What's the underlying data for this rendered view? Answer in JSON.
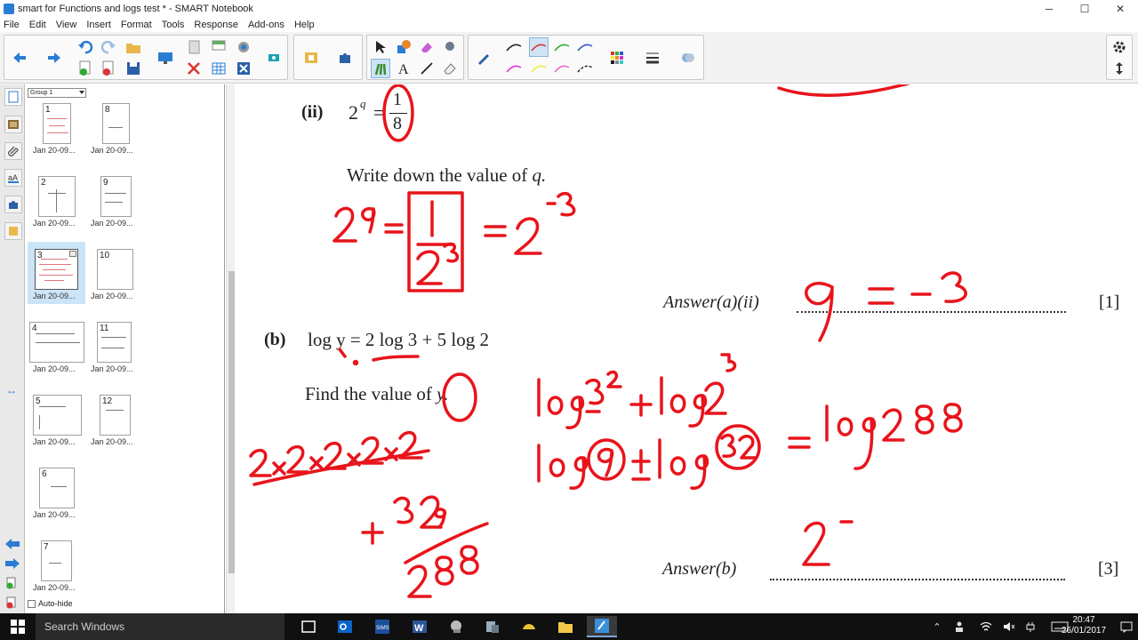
{
  "window": {
    "title": "smart for Functions and logs test * - SMART Notebook",
    "minimize": "─",
    "maximize": "☐",
    "close": "✕"
  },
  "menu": [
    "File",
    "Edit",
    "View",
    "Insert",
    "Format",
    "Tools",
    "Response",
    "Add-ons",
    "Help"
  ],
  "sorter": {
    "group": "Group 1",
    "autohide_label": "Auto-hide",
    "pages": [
      {
        "num": "1",
        "label": "Jan  20-09..."
      },
      {
        "num": "2",
        "label": "Jan  20-09..."
      },
      {
        "num": "3",
        "label": "Jan  20-09..."
      },
      {
        "num": "4",
        "label": "Jan  20-09..."
      },
      {
        "num": "5",
        "label": "Jan  20-09..."
      },
      {
        "num": "6",
        "label": "Jan  20-09..."
      },
      {
        "num": "7",
        "label": "Jan  20-09..."
      },
      {
        "num": "8",
        "label": "Jan  20-09..."
      },
      {
        "num": "9",
        "label": "Jan  20-09..."
      },
      {
        "num": "10",
        "label": "Jan  20-09..."
      },
      {
        "num": "11",
        "label": "Jan  20-09..."
      },
      {
        "num": "12",
        "label": "Jan  20-09..."
      }
    ],
    "selected_page": "3"
  },
  "page": {
    "part_ii": "(ii)",
    "eq_base": "2",
    "eq_exp": "q",
    "eq_equals": "=",
    "frac_num": "1",
    "frac_den": "8",
    "instruction_a": "Write down the value of",
    "instruction_a_var": "q.",
    "answer_a_label": "Answer(a)(ii)",
    "answer_a_mark": "[1]",
    "part_b": "(b)",
    "log_eq": "log y = 2 log 3 + 5 log 2",
    "instruction_b": "Find the value of",
    "instruction_b_var": "y.",
    "answer_b_label": "Answer(b)",
    "answer_b_mark": "[3]"
  },
  "taskbar": {
    "search_placeholder": "Search Windows",
    "time": "20:47",
    "date": "26/01/2017"
  },
  "colors": {
    "ink": "#e8141b",
    "taskbar": "#101010",
    "toolbar": "#f3f3f3"
  }
}
